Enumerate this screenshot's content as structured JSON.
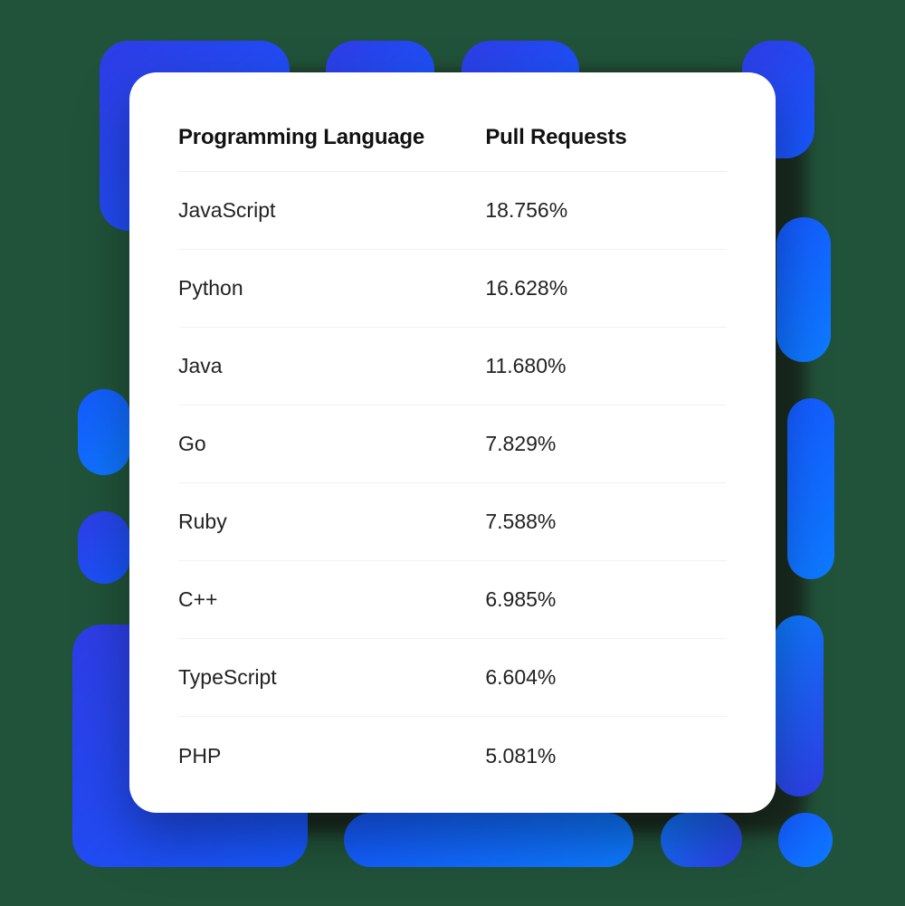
{
  "table": {
    "headers": {
      "language": "Programming Language",
      "pull_requests": "Pull Requests"
    },
    "rows": [
      {
        "language": "JavaScript",
        "pull_requests": "18.756%"
      },
      {
        "language": "Python",
        "pull_requests": "16.628%"
      },
      {
        "language": "Java",
        "pull_requests": "11.680%"
      },
      {
        "language": "Go",
        "pull_requests": "7.829%"
      },
      {
        "language": "Ruby",
        "pull_requests": "7.588%"
      },
      {
        "language": "C++",
        "pull_requests": "6.985%"
      },
      {
        "language": "TypeScript",
        "pull_requests": "6.604%"
      },
      {
        "language": "PHP",
        "pull_requests": "5.081%"
      }
    ]
  },
  "chart_data": {
    "type": "table",
    "title": "",
    "columns": [
      "Programming Language",
      "Pull Requests"
    ],
    "categories": [
      "JavaScript",
      "Python",
      "Java",
      "Go",
      "Ruby",
      "C++",
      "TypeScript",
      "PHP"
    ],
    "values": [
      18.756,
      16.628,
      11.68,
      7.829,
      7.588,
      6.985,
      6.604,
      5.081
    ],
    "unit": "%"
  }
}
